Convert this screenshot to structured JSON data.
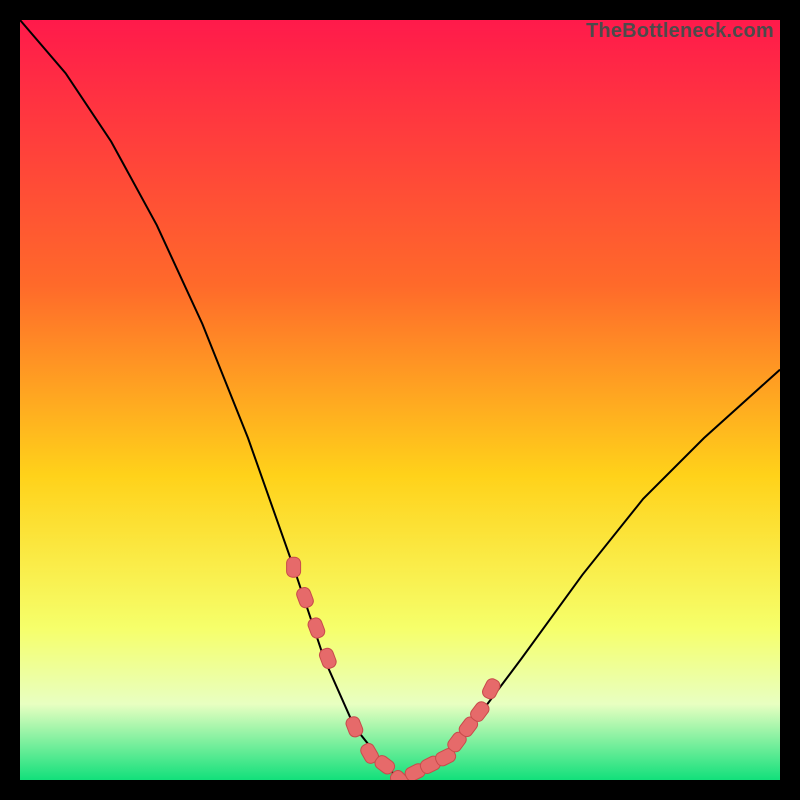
{
  "watermark": "TheBottleneck.com",
  "colors": {
    "bg": "#000000",
    "grad_top": "#ff1a4b",
    "grad_mid1": "#ff6a2a",
    "grad_mid2": "#ffd21a",
    "grad_low": "#f6ff6a",
    "grad_band": "#e8ffc1",
    "grad_bottom": "#12e07b",
    "curve": "#000000",
    "marker_fill": "#e66a6a",
    "marker_stroke": "#c84b4b"
  },
  "chart_data": {
    "type": "line",
    "title": "",
    "xlabel": "",
    "ylabel": "",
    "x_range": [
      0,
      100
    ],
    "y_range": [
      0,
      100
    ],
    "series": [
      {
        "name": "bottleneck-curve",
        "x": [
          0,
          6,
          12,
          18,
          24,
          30,
          36,
          40,
          44,
          48,
          50,
          52,
          56,
          60,
          66,
          74,
          82,
          90,
          100
        ],
        "y": [
          100,
          93,
          84,
          73,
          60,
          45,
          28,
          16,
          7,
          2,
          0,
          1,
          3,
          8,
          16,
          27,
          37,
          45,
          54
        ]
      }
    ],
    "markers": {
      "name": "highlight-points",
      "x": [
        36,
        37.5,
        39,
        40.5,
        44,
        46,
        48,
        50,
        52,
        54,
        56,
        57.5,
        59,
        60.5,
        62
      ],
      "y": [
        28,
        24,
        20,
        16,
        7,
        3.5,
        2,
        0,
        1,
        2,
        3,
        5,
        7,
        9,
        12
      ]
    },
    "gradient_stops": [
      {
        "offset": 0.0,
        "key": "grad_top"
      },
      {
        "offset": 0.35,
        "key": "grad_mid1"
      },
      {
        "offset": 0.6,
        "key": "grad_mid2"
      },
      {
        "offset": 0.8,
        "key": "grad_low"
      },
      {
        "offset": 0.9,
        "key": "grad_band"
      },
      {
        "offset": 1.0,
        "key": "grad_bottom"
      }
    ]
  }
}
